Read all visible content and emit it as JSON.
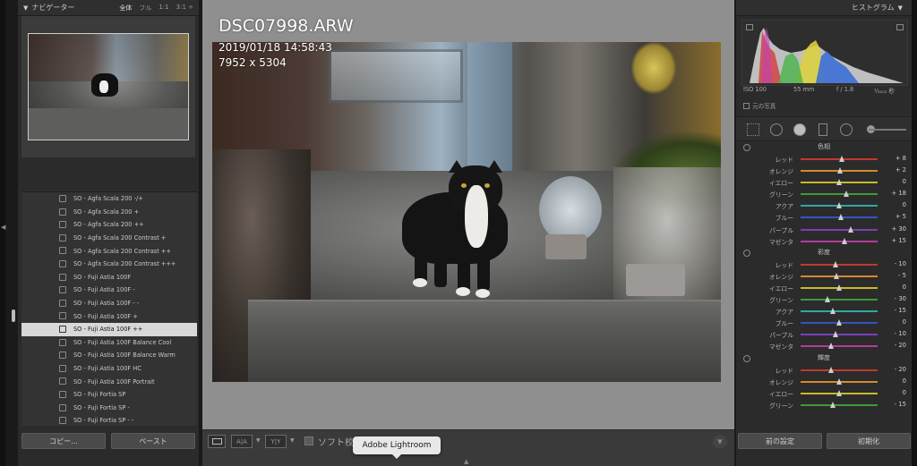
{
  "navigator": {
    "title": "ナビゲーター",
    "options": [
      "全体",
      "フル",
      "1:1",
      "3:1 ÷"
    ]
  },
  "presets": [
    "SO - Agfa Scala 200 -/+",
    "SO - Agfa Scala 200 +",
    "SO - Agfa Scala 200 ++",
    "SO - Agfa Scala 200 Contrast +",
    "SO - Agfa Scala 200 Contrast ++",
    "SO - Agfa Scala 200 Contrast +++",
    "SO - Fuji Astia 100F",
    "SO - Fuji Astia 100F -",
    "SO - Fuji Astia 100F - -",
    "SO - Fuji Astia 100F +",
    "SO - Fuji Astia 100F ++",
    "SO - Fuji Astia 100F Balance Cool",
    "SO - Fuji Astia 100F Balance Warm",
    "SO - Fuji Astia 100F HC",
    "SO - Fuji Astia 100F Portrait",
    "SO - Fuji Fortia SP",
    "SO - Fuji Fortia SP -",
    "SO - Fuji Fortia SP - -"
  ],
  "selected_preset_index": 10,
  "left_buttons": {
    "copy": "コピー...",
    "paste": "ペースト"
  },
  "photo_info": {
    "filename": "DSC07998.ARW",
    "datetime": "2019/01/18 14:58:43",
    "dimensions": "7952 x 5304"
  },
  "toolbar": {
    "view_ab": "A|A",
    "view_yy": "Y|Y",
    "softproof_label": "ソフト校"
  },
  "tooltip": "Adobe Lightroom",
  "histogram": {
    "title": "ヒストグラム",
    "iso": "ISO 100",
    "focal": "55 mm",
    "aperture": "f / 1.8",
    "shutter": "¹⁄₃₂₀₀ 秒",
    "original_photo": "元の写真"
  },
  "hsl": {
    "hue": {
      "title": "色相",
      "rows": [
        {
          "label": "レッド",
          "value": "+ 8",
          "pos": 0.54
        },
        {
          "label": "オレンジ",
          "value": "+ 2",
          "pos": 0.51
        },
        {
          "label": "イエロー",
          "value": "0",
          "pos": 0.5
        },
        {
          "label": "グリーン",
          "value": "+ 18",
          "pos": 0.59
        },
        {
          "label": "アクア",
          "value": "0",
          "pos": 0.5
        },
        {
          "label": "ブルー",
          "value": "+ 5",
          "pos": 0.52
        },
        {
          "label": "パープル",
          "value": "+ 30",
          "pos": 0.65
        },
        {
          "label": "マゼンタ",
          "value": "+ 15",
          "pos": 0.57
        }
      ]
    },
    "saturation": {
      "title": "彩度",
      "rows": [
        {
          "label": "レッド",
          "value": "- 10",
          "pos": 0.45
        },
        {
          "label": "オレンジ",
          "value": "- 5",
          "pos": 0.47
        },
        {
          "label": "イエロー",
          "value": "0",
          "pos": 0.5
        },
        {
          "label": "グリーン",
          "value": "- 30",
          "pos": 0.35
        },
        {
          "label": "アクア",
          "value": "- 15",
          "pos": 0.42
        },
        {
          "label": "ブルー",
          "value": "0",
          "pos": 0.5
        },
        {
          "label": "パープル",
          "value": "- 10",
          "pos": 0.45
        },
        {
          "label": "マゼンタ",
          "value": "- 20",
          "pos": 0.4
        }
      ]
    },
    "luminance": {
      "title": "輝度",
      "rows": [
        {
          "label": "レッド",
          "value": "- 20",
          "pos": 0.4
        },
        {
          "label": "オレンジ",
          "value": "0",
          "pos": 0.5
        },
        {
          "label": "イエロー",
          "value": "0",
          "pos": 0.5
        },
        {
          "label": "グリーン",
          "value": "- 15",
          "pos": 0.42
        }
      ]
    }
  },
  "right_buttons": {
    "previous": "前の設定",
    "reset": "初期化"
  },
  "colors": {
    "red": "#c0392b",
    "orange": "#d68a2e",
    "yellow": "#c9b92c",
    "green": "#3f9a3a",
    "aqua": "#2fa7a7",
    "blue": "#3454c4",
    "purple": "#7a3fb5",
    "magenta": "#b43c9a"
  }
}
